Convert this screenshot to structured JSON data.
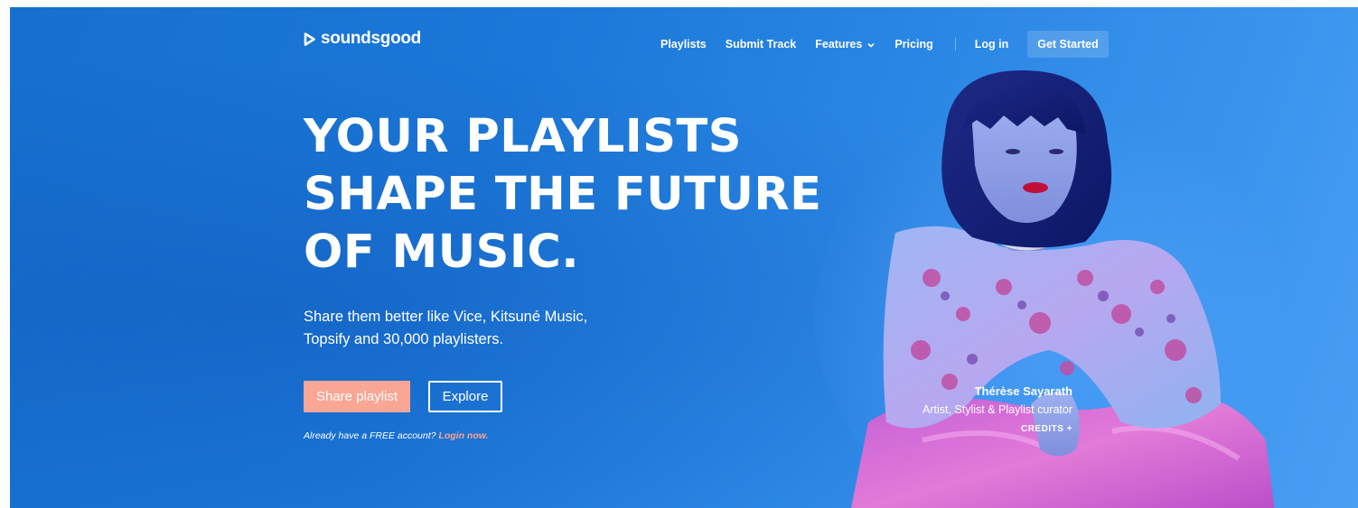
{
  "brand": {
    "name": "soundsgood"
  },
  "nav": {
    "items": [
      {
        "label": "Playlists"
      },
      {
        "label": "Submit Track"
      },
      {
        "label": "Features"
      },
      {
        "label": "Pricing"
      }
    ],
    "login_label": "Log in",
    "cta_label": "Get Started"
  },
  "hero": {
    "headline": [
      "YOUR PLAYLISTS",
      "SHAPE THE FUTURE",
      "OF MUSIC."
    ],
    "subline": [
      "Share them better like Vice, Kitsuné Music,",
      "Topsify and 30,000 playlisters."
    ],
    "primary_button": "Share playlist",
    "secondary_button": "Explore",
    "account_prompt": "Already have a FREE account?",
    "login_link": "Login now."
  },
  "credit": {
    "name": "Thérèse Sayarath",
    "role": "Artist, Stylist & Playlist curator",
    "link": "CREDITS +"
  },
  "colors": {
    "background": "#1b78d8",
    "accent": "#f9a694",
    "text": "#ffffff"
  },
  "icons": {
    "logo": "play-triangle-icon",
    "features_dropdown": "chevron-down-icon"
  }
}
